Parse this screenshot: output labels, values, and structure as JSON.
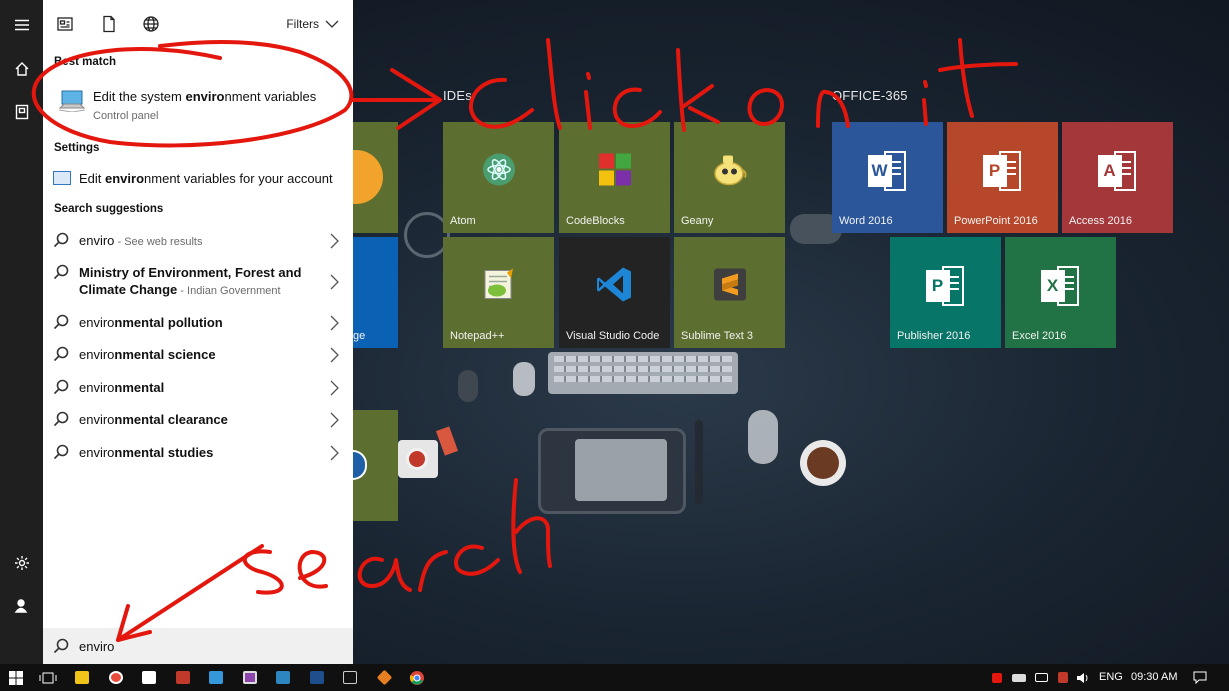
{
  "search_panel": {
    "filters_label": "Filters",
    "best_match_heading": "Best match",
    "best_match": {
      "title_pre": "Edit the system ",
      "title_bold": "enviro",
      "title_post": "nment variables",
      "subtitle": "Control panel"
    },
    "settings_heading": "Settings",
    "setting_item": {
      "pre": "Edit ",
      "bold": "enviro",
      "post": "nment variables for your account"
    },
    "suggestions_heading": "Search suggestions",
    "suggestions": [
      {
        "text": "enviro",
        "extra": " - See web results"
      },
      {
        "line1": "Ministry of Environment, Forest and",
        "line2": "Climate Change",
        "extra": " - Indian Government"
      },
      {
        "pre": "enviro",
        "bold": "nmental pollution"
      },
      {
        "pre": "enviro",
        "bold": "nmental science"
      },
      {
        "pre": "enviro",
        "bold": "nmental"
      },
      {
        "pre": "enviro",
        "bold": "nmental clearance"
      },
      {
        "pre": "enviro",
        "bold": "nmental studies"
      }
    ],
    "query": "enviro"
  },
  "tiles": {
    "group_ides": "IDEs",
    "group_office": "OFFICE-365",
    "ide_tiles": [
      {
        "label": "Atom"
      },
      {
        "label": "CodeBlocks"
      },
      {
        "label": "Geany"
      },
      {
        "label": "Notepad++"
      },
      {
        "label": "Visual Studio Code"
      },
      {
        "label": "Sublime Text 3"
      }
    ],
    "office_tiles": [
      {
        "label": "Word 2016",
        "letter": "W"
      },
      {
        "label": "PowerPoint 2016",
        "letter": "P"
      },
      {
        "label": "Access 2016",
        "letter": "A"
      },
      {
        "label": "Publisher 2016",
        "letter": "P"
      },
      {
        "label": "Excel 2016",
        "letter": "X"
      }
    ],
    "partial_label": "ge"
  },
  "taskbar": {
    "language": "ENG",
    "clock": "09:30 AM"
  },
  "colors": {
    "annotation_red": "#e3170d",
    "tile_green": "#5c6f30",
    "word_blue": "#2b579a",
    "ppt_orange": "#b7472a",
    "access_red": "#a4373a",
    "publisher_teal": "#077568",
    "excel_green": "#217346"
  }
}
